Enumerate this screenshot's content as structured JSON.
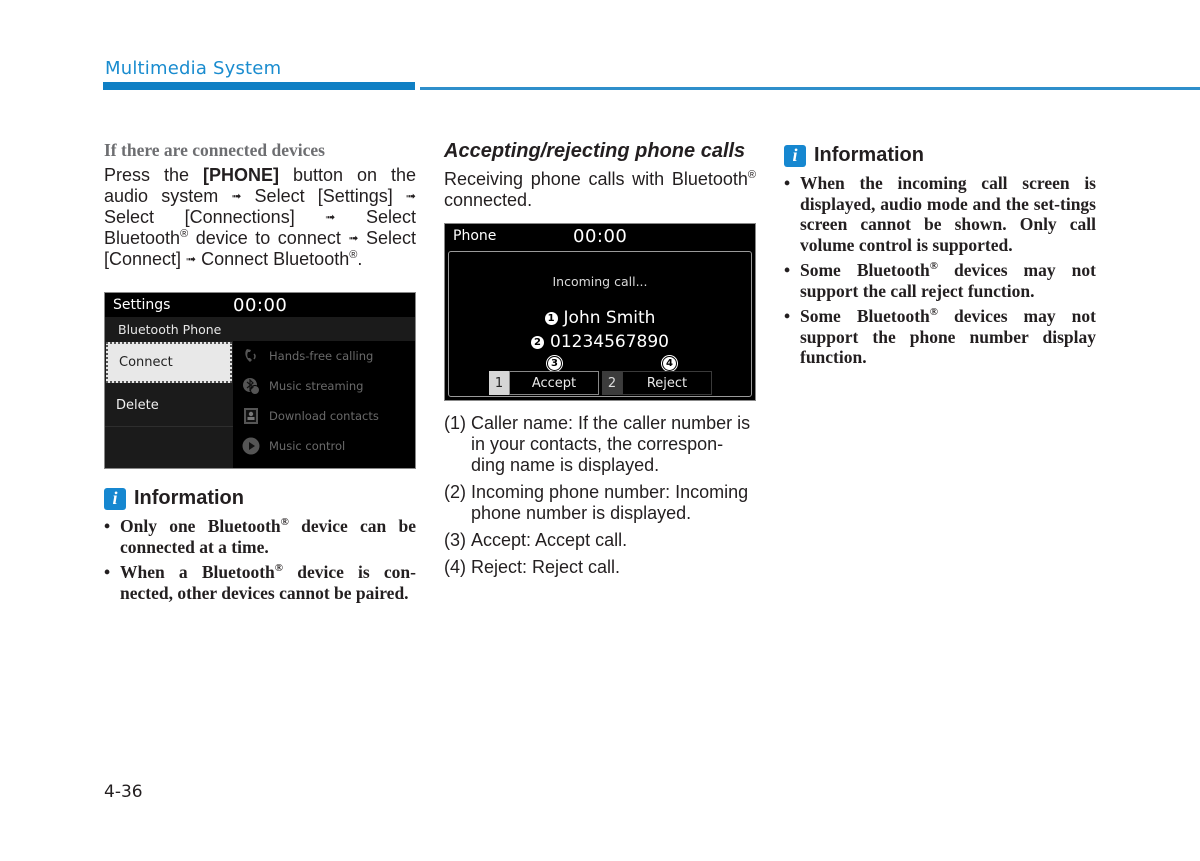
{
  "header": {
    "section_title": "Multimedia System",
    "accent_color": "#0f7fc4"
  },
  "column1": {
    "subheading": "If there are connected devices",
    "instructions": {
      "part1": "Press the ",
      "bold": "[PHONE]",
      "part2": " button on the audio system ",
      "step2": " Select [Settings] ",
      "step3": " Select [Connections] ",
      "step4": " Select Bluetooth",
      "step4b": " device to connect ",
      "step5": " Select [Connect] ",
      "step6": " Connect Bluetooth",
      "end": ".",
      "arrow": "➟",
      "reg": "®"
    },
    "settings_screen": {
      "title": "Settings",
      "clock": "00:00",
      "submenu": "Bluetooth Phone",
      "left_items": [
        {
          "label": "Connect",
          "selected": true
        },
        {
          "label": "Delete",
          "selected": false
        }
      ],
      "features": [
        {
          "icon": "phone-handsfree-icon",
          "label": "Hands-free calling"
        },
        {
          "icon": "bluetooth-music-icon",
          "label": "Music streaming"
        },
        {
          "icon": "contacts-icon",
          "label": "Download contacts"
        },
        {
          "icon": "play-icon",
          "label": "Music control"
        }
      ]
    },
    "info": {
      "badge": "i",
      "title": "Information",
      "bullets": [
        {
          "a": "Only one Bluetooth",
          "b": " device can be connected at a time."
        },
        {
          "a": "When a Bluetooth",
          "b": " device is con-nected, other devices cannot be paired."
        }
      ]
    }
  },
  "column2": {
    "heading": "Accepting/rejecting phone calls",
    "intro_a": "Receiving phone calls with Bluetooth",
    "intro_b": " connected.",
    "phone_screen": {
      "title": "Phone",
      "clock": "00:00",
      "status": "Incoming call...",
      "caller_name": "John Smith",
      "caller_number": "01234567890",
      "callouts": [
        "1",
        "2",
        "3",
        "4"
      ],
      "accept": {
        "key": "1",
        "label": "Accept"
      },
      "reject": {
        "key": "2",
        "label": "Reject"
      }
    },
    "legend": [
      {
        "num": "(1)",
        "text": "Caller name: If the caller number is in your contacts, the correspon-ding name is displayed."
      },
      {
        "num": "(2)",
        "text": "Incoming phone number: Incoming phone number is displayed."
      },
      {
        "num": "(3)",
        "text": "Accept: Accept call."
      },
      {
        "num": "(4)",
        "text": "Reject: Reject call."
      }
    ]
  },
  "column3": {
    "info": {
      "badge": "i",
      "title": "Information",
      "bullets": [
        {
          "a": "When the incoming call screen is displayed, audio mode and the set-tings screen cannot be shown. Only call volume control is supported.",
          "b": ""
        },
        {
          "a": "Some Bluetooth",
          "b": " devices may not support the call reject function."
        },
        {
          "a": "Some Bluetooth",
          "b": " devices may not support the phone number display function."
        }
      ]
    }
  },
  "footer": {
    "page_number": "4-36"
  }
}
